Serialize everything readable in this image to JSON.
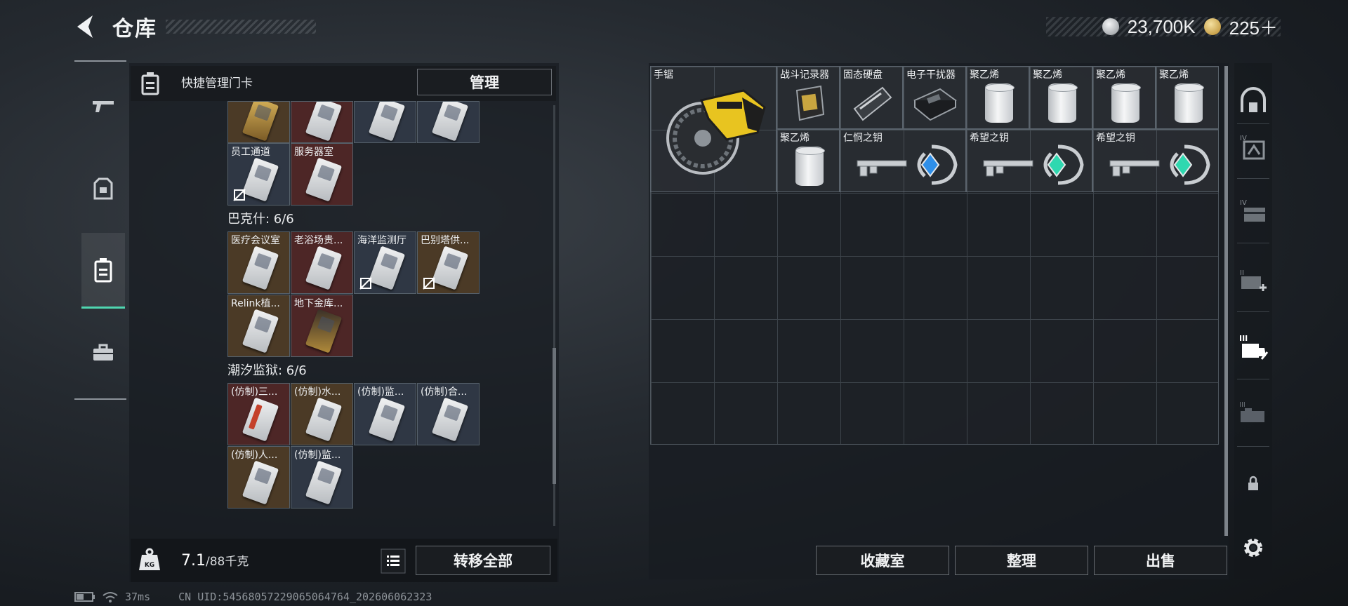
{
  "header": {
    "title": "仓库",
    "currency1_value": "23,700K",
    "currency2_value": "225＋"
  },
  "left_nav": {
    "items": [
      "weapon-icon",
      "armor-icon",
      "keycard-icon",
      "toolbox-icon"
    ],
    "active_index": 2
  },
  "left_panel": {
    "header_label": "快捷管理门卡",
    "manage_button": "管理",
    "top_row_cells": [
      "",
      "",
      "",
      ""
    ],
    "group_a_cells": [
      {
        "label": "员工通道",
        "locked": true
      },
      {
        "label": "服务器室",
        "locked": false
      }
    ],
    "section_bakeshi": "巴克什: 6/6",
    "group_b_cells": [
      {
        "label": "医疗会议室",
        "locked": false
      },
      {
        "label": "老浴场贵...",
        "locked": false
      },
      {
        "label": "海洋监测厅",
        "locked": true
      },
      {
        "label": "巴别塔供...",
        "locked": true
      },
      {
        "label": "Relink植...",
        "locked": false
      },
      {
        "label": "地下金库...",
        "locked": false
      }
    ],
    "section_chaoxi": "潮汐监狱: 6/6",
    "group_c_cells": [
      {
        "label": "(仿制)三..."
      },
      {
        "label": "(仿制)水..."
      },
      {
        "label": "(仿制)监..."
      },
      {
        "label": "(仿制)合..."
      },
      {
        "label": "(仿制)人..."
      },
      {
        "label": "(仿制)监..."
      }
    ],
    "weight_value": "7.1",
    "weight_capacity": "/88千克",
    "transfer_all_button": "转移全部"
  },
  "right_panel": {
    "items": [
      {
        "label": "手锯"
      },
      {
        "label": "战斗记录器"
      },
      {
        "label": "固态硬盘"
      },
      {
        "label": "电子干扰器"
      },
      {
        "label": "聚乙烯"
      },
      {
        "label": "聚乙烯"
      },
      {
        "label": "聚乙烯"
      },
      {
        "label": "聚乙烯"
      },
      {
        "label": "聚乙烯"
      },
      {
        "label": "仁恫之钥"
      },
      {
        "label": "希望之钥"
      },
      {
        "label": "希望之钥"
      }
    ],
    "collection_button": "收藏室",
    "sort_button": "整理",
    "sell_button": "出售"
  },
  "right_sidebar": {
    "icons": [
      "safehouse-icon",
      "storage-tier-4-icon",
      "storage-tier-4b-icon",
      "storage-tier-2-add-icon",
      "storage-tier-3-active-icon",
      "storage-tier-3-icon",
      "lock-icon",
      "settings-icon"
    ]
  },
  "status_bar": {
    "ping": "37ms",
    "uid": "CN UID:5456805722906506476​4_202606062323"
  },
  "colors": {
    "accent": "#4fd6b0",
    "cell_red": "#4d2626",
    "cell_gold": "#4b3a26",
    "cell_blue": "#2f3744",
    "key_gem_blue": "#2f8fe8",
    "key_gem_teal": "#2fd8b0"
  }
}
